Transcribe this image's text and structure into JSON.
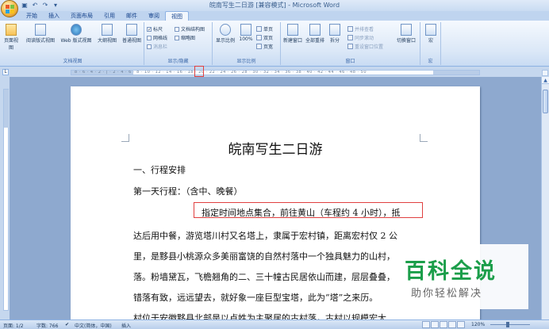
{
  "window": {
    "title": "皖南写生二日游 [兼容模式] - Microsoft Word"
  },
  "tabs": [
    "开始",
    "插入",
    "页面布局",
    "引用",
    "邮件",
    "审阅",
    "视图"
  ],
  "active_tab": "视图",
  "ribbon": {
    "doc_views": {
      "label": "文档视图",
      "buttons": [
        "页面视图",
        "阅读版式视图",
        "Web 版式视图",
        "大纲视图",
        "普通视图"
      ]
    },
    "show_hide": {
      "label": "显示/隐藏",
      "ruler": "标尺",
      "gridlines": "网格线",
      "message_bar": "消息栏",
      "doc_map": "文档结构图",
      "thumbnails": "缩略图"
    },
    "zoom": {
      "label": "显示比例",
      "zoom_btn": "显示比例",
      "hundred": "100%",
      "one_page": "单页",
      "two_pages": "双页",
      "page_width": "页宽"
    },
    "window": {
      "label": "窗口",
      "new_window": "新建窗口",
      "arrange_all": "全部重排",
      "split": "拆分",
      "side_by_side": "并排查看",
      "sync_scroll": "同步滚动",
      "reset_pos": "重设窗口位置",
      "switch_window": "切换窗口"
    },
    "macros": {
      "label": "宏",
      "btn": "宏"
    }
  },
  "ruler": {
    "numbers": "8 · 6 · 4 · 2 · | · 2 · 4 · 6 · 8 · 10 · 12 · 14 · 16 · 18 · 20 · 22 · 24 · 26 · 28 · 30 · 32 · 34 · 36 · 38 · 40 · 42 · 44 · 46 · 48 · 50",
    "tab_marker": "L"
  },
  "document": {
    "title": "皖南写生二日游",
    "lines": [
      "一、行程安排",
      "第一天行程：（含中、晚餐）",
      "指定时间地点集合，前往黄山（车程约 4 小时），抵",
      "达后用中餐，游览塔川村又名塔上，隶属于宏村镇，距离宏村仅 2 公",
      "里，是黟县小桃源众多美丽富饶的自然村落中一个独具魅力的山村，",
      "落。粉墙黛瓦，飞檐翘角的二、三十幢古民居依山而建，层层叠叠，",
      "错落有致，远远望去，就好象一座巨型宝塔，此为“塔”之来历。",
      "村位于安徽黟县北部是以卢姓为主聚居的古村落，古村以规模宏大、"
    ]
  },
  "statusbar": {
    "page": "页面: 1/2",
    "words": "字数: 766",
    "language": "中文(简体，中国)",
    "mode": "插入",
    "zoom": "120%"
  },
  "watermark": {
    "main": "百科全说",
    "sub": "助你轻松解决"
  },
  "colors": {
    "accent": "#1b9e4a",
    "highlight": "#e04040"
  }
}
